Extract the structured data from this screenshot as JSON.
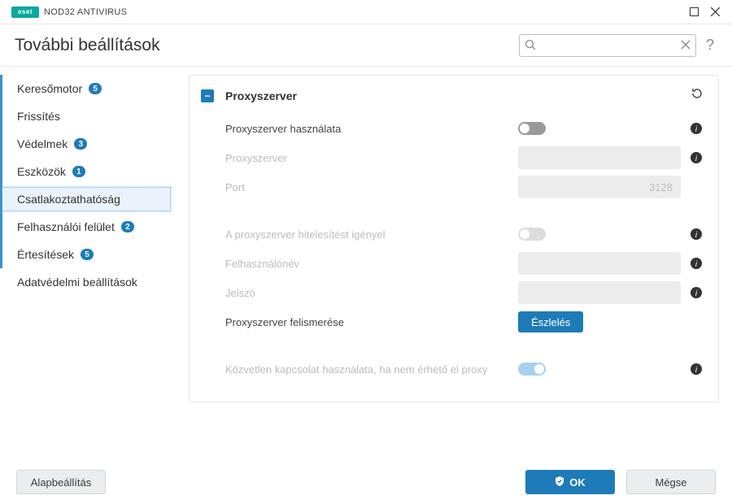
{
  "titlebar": {
    "logo_text": "eset",
    "product": "NOD32 ANTIVIRUS"
  },
  "header": {
    "title": "További beállítások",
    "search_value": ""
  },
  "sidebar": {
    "items": [
      {
        "label": "Keresőmotor",
        "badge": "5"
      },
      {
        "label": "Frissítés",
        "badge": null
      },
      {
        "label": "Védelmek",
        "badge": "3"
      },
      {
        "label": "Eszközök",
        "badge": "1"
      },
      {
        "label": "Csatlakoztathatóság",
        "badge": null
      },
      {
        "label": "Felhasználói felület",
        "badge": "2"
      },
      {
        "label": "Értesítések",
        "badge": "5"
      },
      {
        "label": "Adatvédelmi beállítások",
        "badge": null
      }
    ]
  },
  "panel": {
    "title": "Proxyszerver",
    "rows": {
      "use_proxy": {
        "label": "Proxyszerver használata"
      },
      "server": {
        "label": "Proxyszerver",
        "value": ""
      },
      "port": {
        "label": "Port",
        "value": "3128"
      },
      "auth": {
        "label": "A proxyszerver hitelesítést igényel"
      },
      "user": {
        "label": "Felhasználónév",
        "value": ""
      },
      "pass": {
        "label": "Jelszó",
        "value": ""
      },
      "detect": {
        "label": "Proxyszerver felismerése",
        "button": "Észlelés"
      },
      "direct": {
        "label": "Közvetlen kapcsolat használata, ha nem érhető el proxy"
      }
    }
  },
  "footer": {
    "default": "Alapbeállítás",
    "ok": "OK",
    "cancel": "Mégse"
  }
}
